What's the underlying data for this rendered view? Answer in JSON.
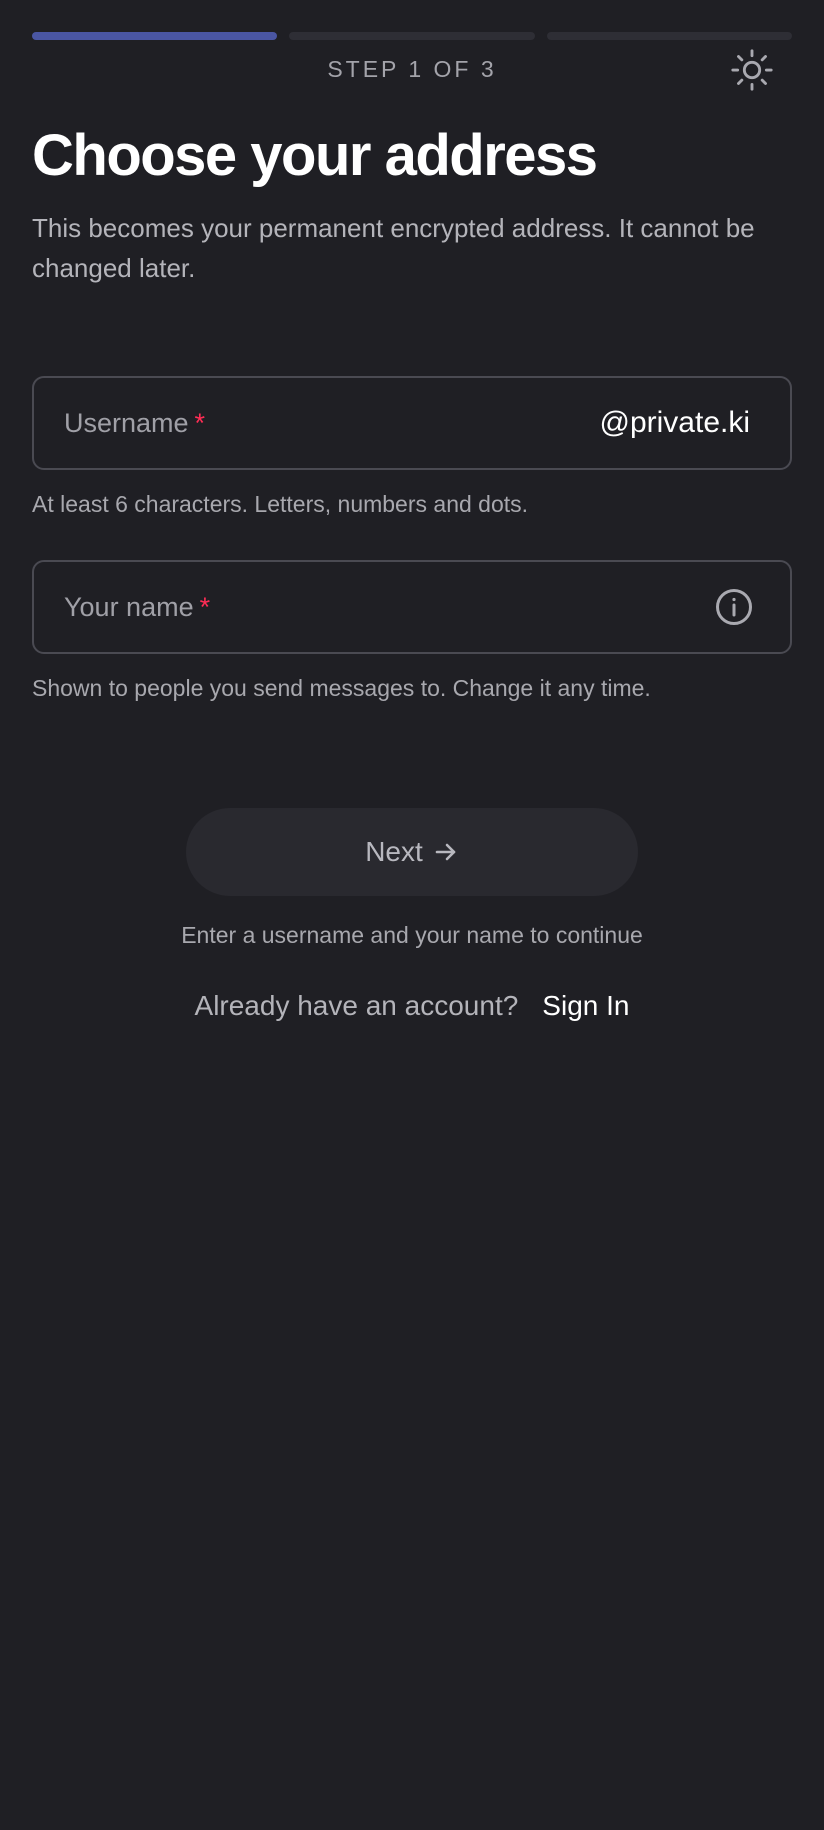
{
  "progress": {
    "total_steps": 3,
    "current_step": 1,
    "step_label": "STEP 1 OF 3",
    "active_color": "#4a56a3",
    "inactive_color": "#2e2e35"
  },
  "header": {
    "theme_toggle_icon": "sun-icon"
  },
  "main": {
    "title": "Choose your address",
    "subtitle": "This becomes your permanent encrypted address. It cannot be changed later."
  },
  "form": {
    "username": {
      "placeholder": "Username",
      "required_marker": "*",
      "suffix": "@private.ki",
      "value": "",
      "help": "At least 6 characters. Letters, numbers and dots."
    },
    "full_name": {
      "placeholder": "Your name",
      "required_marker": "*",
      "value": "",
      "info_icon": "info-icon",
      "help": "Shown to people you send messages to. Change it any time."
    }
  },
  "actions": {
    "next_label": "Next",
    "next_icon": "arrow-right-icon",
    "next_enabled": false,
    "continue_hint": "Enter a username and your name to continue",
    "signin_question": "Already have an account?",
    "signin_link": "Sign In"
  },
  "colors": {
    "background": "#1f1f24",
    "required": "#ff2d55",
    "field_border": "#4a4a52"
  }
}
